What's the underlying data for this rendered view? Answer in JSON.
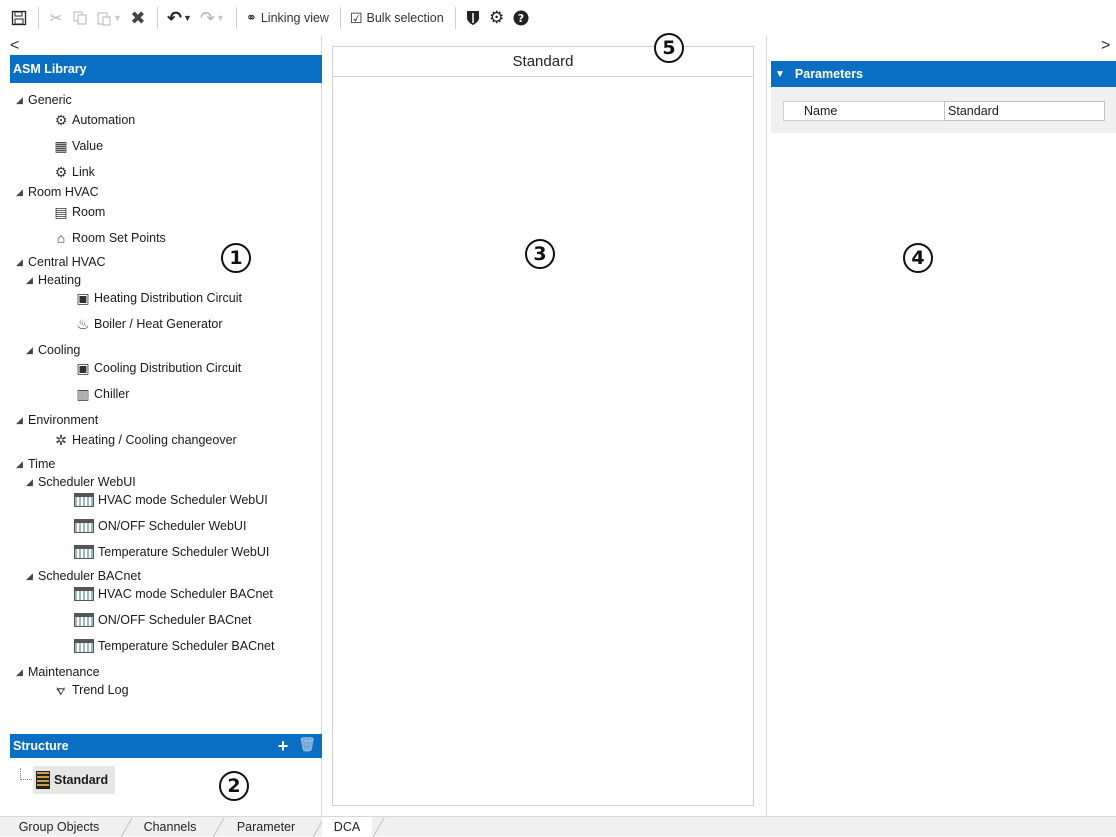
{
  "toolbar": {
    "linking_view": "Linking view",
    "bulk_selection": "Bulk selection"
  },
  "left": {
    "collapse_arrow": "<",
    "library_title": "ASM Library",
    "tree": [
      {
        "label": "Generic",
        "kind": "group"
      },
      {
        "label": "Automation",
        "kind": "item",
        "icon": "gear-icon"
      },
      {
        "label": "Value",
        "kind": "item",
        "icon": "value-icon"
      },
      {
        "label": "Link",
        "kind": "item",
        "icon": "link-icon"
      },
      {
        "label": "Room HVAC",
        "kind": "group"
      },
      {
        "label": "Room",
        "kind": "item",
        "icon": "room-icon"
      },
      {
        "label": "Room Set Points",
        "kind": "item",
        "icon": "setpoint-icon"
      },
      {
        "label": "Central HVAC",
        "kind": "group"
      },
      {
        "label": "Heating",
        "kind": "subgroup"
      },
      {
        "label": "Heating Distribution Circuit",
        "kind": "subitem",
        "icon": "circuit-icon"
      },
      {
        "label": "Boiler / Heat Generator",
        "kind": "subitem",
        "icon": "boiler-icon"
      },
      {
        "label": "Cooling",
        "kind": "subgroup"
      },
      {
        "label": "Cooling Distribution Circuit",
        "kind": "subitem",
        "icon": "circuit-icon"
      },
      {
        "label": "Chiller",
        "kind": "subitem",
        "icon": "chiller-icon"
      },
      {
        "label": "Environment",
        "kind": "group"
      },
      {
        "label": "Heating / Cooling changeover",
        "kind": "item",
        "icon": "changeover-icon"
      },
      {
        "label": "Time",
        "kind": "group"
      },
      {
        "label": "Scheduler WebUI",
        "kind": "subgroup"
      },
      {
        "label": "HVAC mode Scheduler WebUI",
        "kind": "subitem",
        "icon": "scheduler-icon"
      },
      {
        "label": "ON/OFF Scheduler WebUI",
        "kind": "subitem",
        "icon": "scheduler-icon"
      },
      {
        "label": "Temperature Scheduler WebUI",
        "kind": "subitem",
        "icon": "scheduler-icon"
      },
      {
        "label": "Scheduler BACnet",
        "kind": "subgroup"
      },
      {
        "label": "HVAC mode Scheduler BACnet",
        "kind": "subitem",
        "icon": "scheduler-icon"
      },
      {
        "label": "ON/OFF Scheduler BACnet",
        "kind": "subitem",
        "icon": "scheduler-icon"
      },
      {
        "label": "Temperature Scheduler BACnet",
        "kind": "subitem",
        "icon": "scheduler-icon"
      },
      {
        "label": "Maintenance",
        "kind": "group"
      },
      {
        "label": "Trend Log",
        "kind": "item",
        "icon": "trend-log-icon"
      }
    ],
    "structure_title": "Structure",
    "structure_item": "Standard"
  },
  "center": {
    "title": "Standard"
  },
  "right": {
    "collapse_arrow": ">",
    "params_title": "Parameters",
    "param_name_label": "Name",
    "param_name_value": "Standard"
  },
  "callouts": [
    "1",
    "2",
    "3",
    "4",
    "5"
  ],
  "tabs": [
    "Group Objects",
    "Channels",
    "Parameter",
    "DCA"
  ],
  "active_tab": "DCA",
  "colors": {
    "header_blue": "#0a6fc2"
  }
}
